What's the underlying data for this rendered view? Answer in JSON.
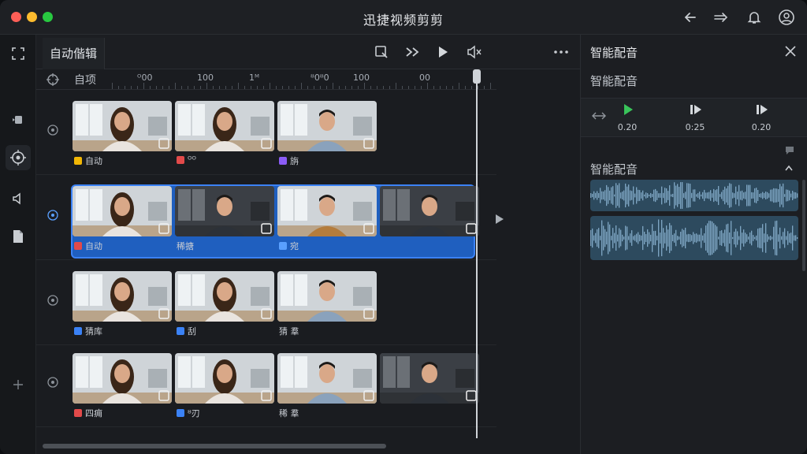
{
  "app": {
    "title": "迅捷视频剪剪"
  },
  "editor": {
    "tab_label": "自动偕辑"
  },
  "ruler": {
    "first": "自项",
    "labels": [
      "ᴼ00",
      "100",
      "1ᴹ",
      "ᴽ0ᴽ0",
      "100",
      "00"
    ]
  },
  "tracks": [
    {
      "clips": [
        {
          "caption": "自动",
          "badge_color": "#f2b705",
          "scene": "woman-a"
        },
        {
          "caption": "ᴼᴼ",
          "badge_color": "#e24a4a",
          "scene": "woman-b"
        },
        {
          "caption": "旃",
          "badge_color": "#8b5cf6",
          "scene": "man-a"
        }
      ]
    },
    {
      "selected": true,
      "clips": [
        {
          "caption": "自动",
          "badge_color": "#e24a4a",
          "scene": "woman-a"
        },
        {
          "caption": "稀搪",
          "badge_color": "",
          "scene": "man-b"
        },
        {
          "caption": "宛",
          "badge_color": "#5aa0ff",
          "scene": "man-c"
        },
        {
          "caption": "",
          "badge_color": "",
          "scene": "man-d"
        }
      ]
    },
    {
      "clips": [
        {
          "caption": "猜库",
          "badge_color": "#3b82f6",
          "scene": "woman-c"
        },
        {
          "caption": "刮",
          "badge_color": "#3b82f6",
          "scene": "woman-d"
        },
        {
          "caption": "猜 羣",
          "badge_color": "",
          "scene": "man-e"
        }
      ]
    },
    {
      "clips": [
        {
          "caption": "四痈",
          "badge_color": "#e24a4a",
          "scene": "woman-a"
        },
        {
          "caption": "ᴽ刃",
          "badge_color": "#3b82f6",
          "scene": "woman-b"
        },
        {
          "caption": "稀 羣",
          "badge_color": "",
          "scene": "man-f"
        },
        {
          "caption": "",
          "badge_color": "",
          "scene": "man-g"
        }
      ]
    }
  ],
  "panel": {
    "title": "智能配音",
    "subtitle": "智能配音",
    "controls": [
      {
        "value": "0.20",
        "icon": "play-icon"
      },
      {
        "value": "0:25",
        "icon": "step-icon"
      },
      {
        "value": "0.20",
        "icon": "step-icon"
      }
    ],
    "section_title": "智能配音"
  },
  "colors": {
    "accent": "#3b82f6",
    "selection": "#1f5fbf",
    "play_green": "#39c45a"
  }
}
